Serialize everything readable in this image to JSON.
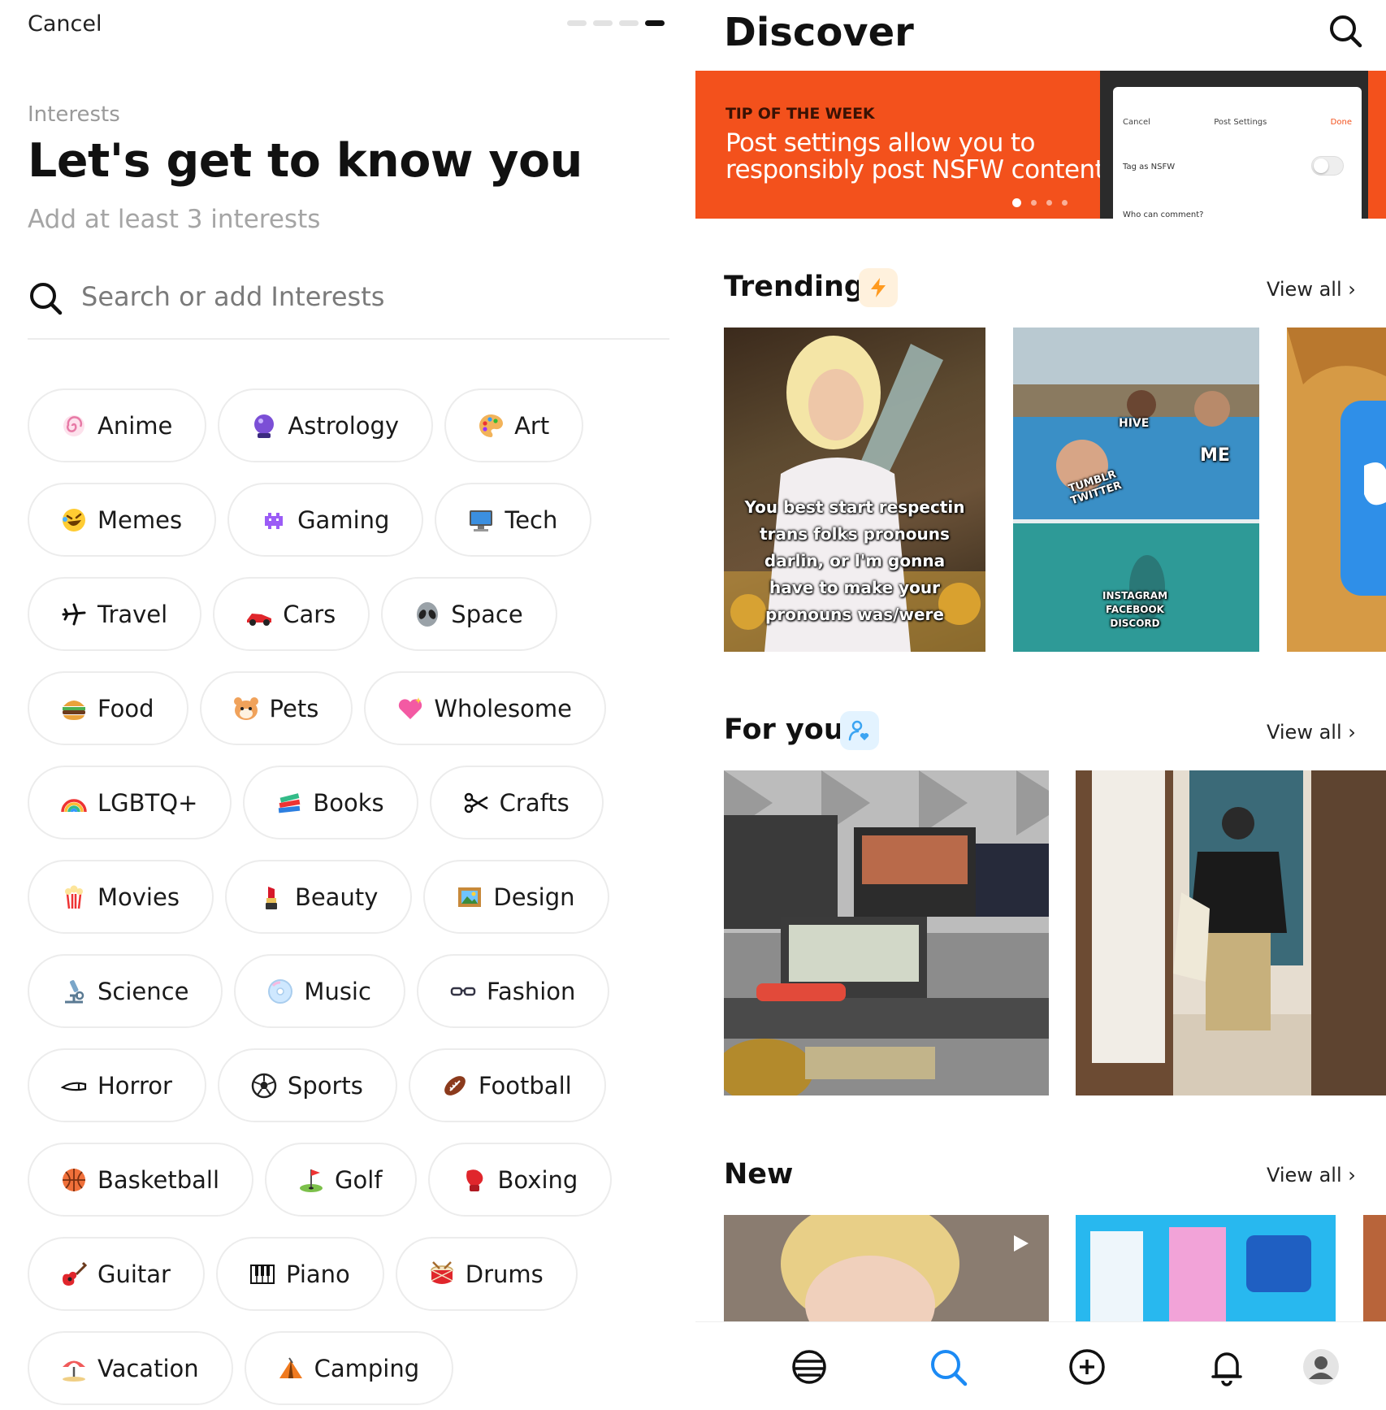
{
  "onboarding": {
    "cancel_label": "Cancel",
    "step": {
      "current": 4,
      "total": 4
    },
    "kicker": "Interests",
    "title": "Let's get to know you",
    "subtitle": "Add at least 3 interests",
    "search_placeholder": "Search or add Interests",
    "chip_rows": [
      [
        {
          "label": "Anime",
          "icon": "spiral-icon"
        },
        {
          "label": "Astrology",
          "icon": "crystal-ball-icon"
        },
        {
          "label": "Art",
          "icon": "palette-icon"
        }
      ],
      [
        {
          "label": "Memes",
          "icon": "laughing-face-icon"
        },
        {
          "label": "Gaming",
          "icon": "space-invader-icon"
        },
        {
          "label": "Tech",
          "icon": "computer-icon"
        }
      ],
      [
        {
          "label": "Travel",
          "icon": "airplane-icon"
        },
        {
          "label": "Cars",
          "icon": "race-car-icon"
        },
        {
          "label": "Space",
          "icon": "alien-icon"
        }
      ],
      [
        {
          "label": "Food",
          "icon": "burger-icon"
        },
        {
          "label": "Pets",
          "icon": "hamster-icon"
        },
        {
          "label": "Wholesome",
          "icon": "sparkling-heart-icon"
        }
      ],
      [
        {
          "label": "LGBTQ+",
          "icon": "rainbow-icon"
        },
        {
          "label": "Books",
          "icon": "books-icon"
        },
        {
          "label": "Crafts",
          "icon": "scissors-icon"
        }
      ],
      [
        {
          "label": "Movies",
          "icon": "popcorn-icon"
        },
        {
          "label": "Beauty",
          "icon": "lipstick-icon"
        },
        {
          "label": "Design",
          "icon": "framed-picture-icon"
        }
      ],
      [
        {
          "label": "Science",
          "icon": "microscope-icon"
        },
        {
          "label": "Music",
          "icon": "cd-icon"
        },
        {
          "label": "Fashion",
          "icon": "glasses-icon"
        }
      ],
      [
        {
          "label": "Horror",
          "icon": "knife-icon"
        },
        {
          "label": "Sports",
          "icon": "soccer-ball-icon"
        },
        {
          "label": "Football",
          "icon": "american-football-icon"
        }
      ],
      [
        {
          "label": "Basketball",
          "icon": "basketball-icon"
        },
        {
          "label": "Golf",
          "icon": "golf-flag-icon"
        },
        {
          "label": "Boxing",
          "icon": "boxing-glove-icon"
        }
      ],
      [
        {
          "label": "Guitar",
          "icon": "guitar-icon"
        },
        {
          "label": "Piano",
          "icon": "piano-keys-icon"
        },
        {
          "label": "Drums",
          "icon": "drum-icon"
        }
      ],
      [
        {
          "label": "Vacation",
          "icon": "beach-umbrella-icon"
        },
        {
          "label": "Camping",
          "icon": "tent-icon"
        }
      ]
    ]
  },
  "discover": {
    "title": "Discover",
    "banner": {
      "kicker": "TIP OF THE WEEK",
      "headline": "Post settings allow you to responsibly post NSFW content",
      "slide_count": 4,
      "active_slide": 1,
      "phone": {
        "cancel": "Cancel",
        "title": "Post Settings",
        "done": "Done",
        "nsfw_row": "Tag as NSFW",
        "comment_row": "Who can comment?"
      }
    },
    "sections": {
      "trending": {
        "title": "Trending",
        "view_all": "View all",
        "icon": "lightning-icon"
      },
      "for_you": {
        "title": "For you",
        "view_all": "View all",
        "icon": "person-heart-icon"
      },
      "new": {
        "title": "New",
        "view_all": "View all"
      }
    },
    "trending_tiles": {
      "meme1_caption": "You best start respectin trans folks pronouns darlin, or I'm gonna have to make your pronouns was/were",
      "meme2_labels": {
        "hive": "HIVE",
        "me": "ME",
        "tumblr": "TUMBLR TWITTER",
        "bottom": "INSTAGRAM FACEBOOK DISCORD"
      }
    },
    "tabbar": [
      {
        "name": "home-tab",
        "icon": "tumbleweed-icon"
      },
      {
        "name": "discover-tab",
        "icon": "search-icon",
        "active": true
      },
      {
        "name": "create-tab",
        "icon": "plus-circle-icon"
      },
      {
        "name": "notifications-tab",
        "icon": "bell-icon"
      },
      {
        "name": "profile-tab",
        "icon": "avatar-icon"
      }
    ],
    "colors": {
      "brand": "#f3511c",
      "active_tab": "#1b8af4",
      "trending_badge": "#fff1dd",
      "foryou_badge": "#e3f3ff"
    }
  }
}
